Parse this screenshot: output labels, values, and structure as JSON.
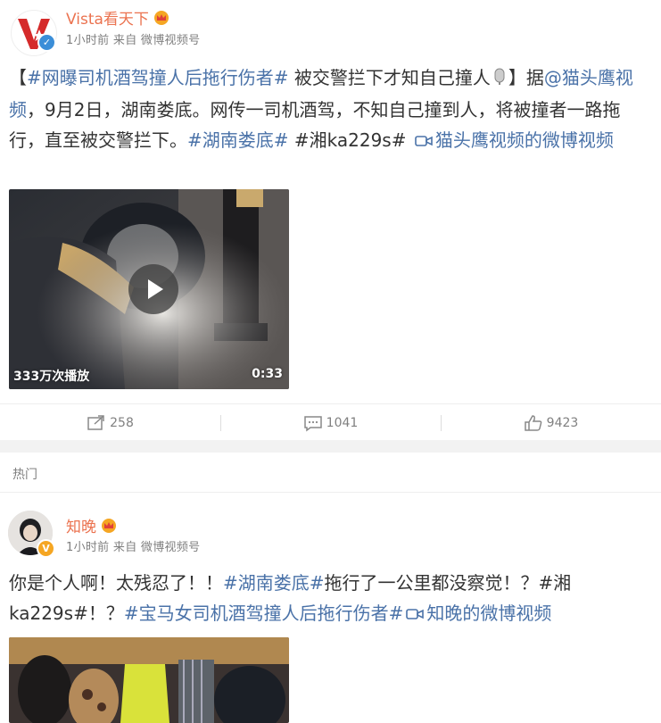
{
  "post1": {
    "author": "Vista看天下",
    "meta": "1小时前 来自 微博视频号",
    "text": {
      "bracket_open": "【",
      "topic1": "#网曝司机酒驾撞人后拖行伤者#",
      "seg1": " 被交警拦下才知自己撞人",
      "seg2": "】据",
      "mention": "@猫头鹰视频",
      "seg3": "，9月2日，湖南娄底。网传一司机酒驾，不知自己撞到人，将被撞者一路拖行，直至被交警拦下。",
      "topic2": "#湖南娄底#",
      "seg4": " #湘ka229s# ",
      "video_link": "猫头鹰视频的微博视频"
    },
    "video": {
      "views": "333万次播放",
      "duration": "0:33"
    },
    "actions": {
      "repost": "258",
      "comment": "1041",
      "like": "9423"
    }
  },
  "hot_label": "热门",
  "post2": {
    "author": "知晚",
    "meta": "1小时前 来自 微博视频号",
    "text": {
      "seg1": "你是个人啊！太残忍了！！",
      "topic1": "#湖南娄底#",
      "seg2": "拖行了一公里都没察觉！？#湘ka229s#！？",
      "topic2": "#宝马女司机酒驾撞人后拖行伤者#",
      "video_link": "知晚的微博视频"
    }
  },
  "colors": {
    "name": "#eb7350",
    "link": "#4a72a8",
    "meta": "#808080",
    "brand_red": "#d52a2a"
  }
}
